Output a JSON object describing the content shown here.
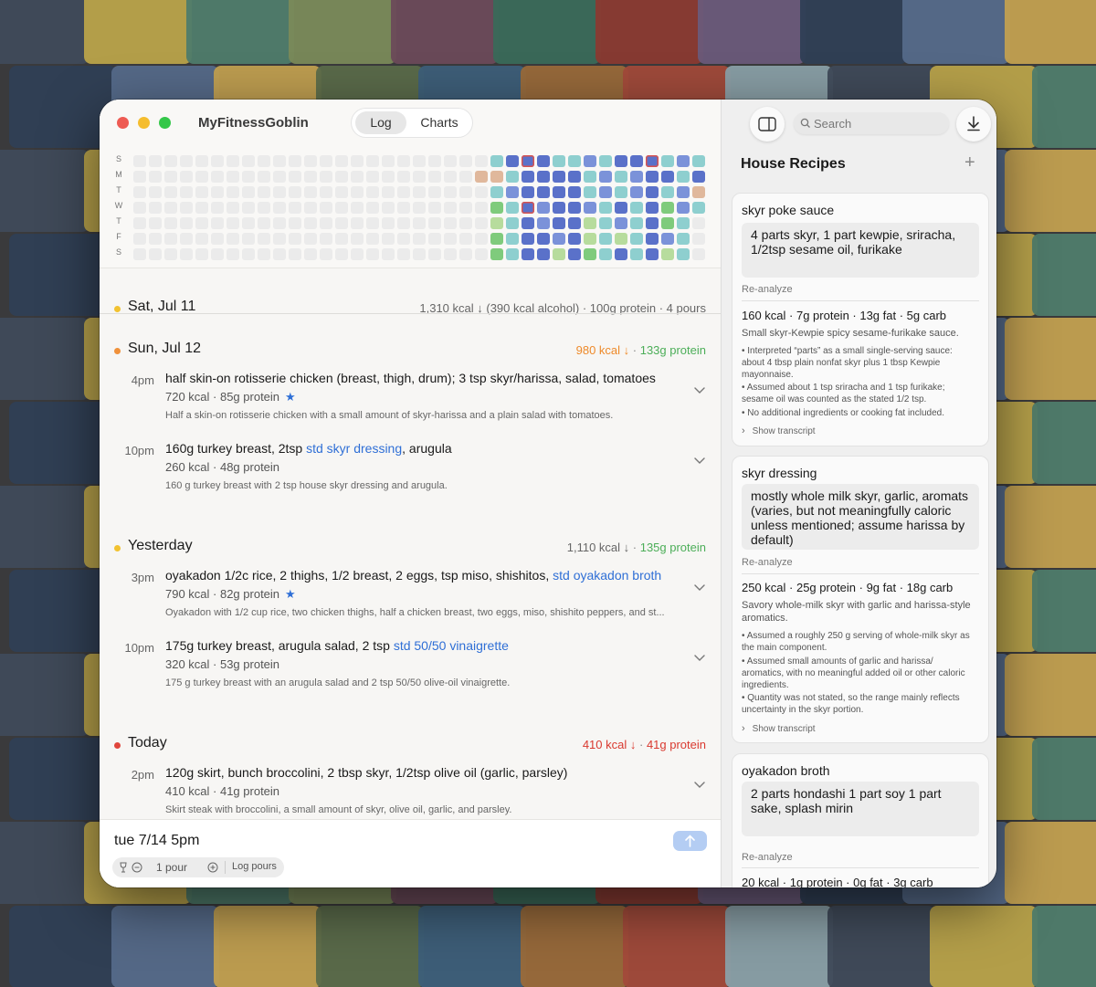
{
  "app": {
    "title": "MyFitnessGoblin",
    "tabs": [
      "Log",
      "Charts"
    ],
    "active_tab": "Log"
  },
  "heatmap": {
    "day_labels": [
      "S",
      "M",
      "T",
      "W",
      "T",
      "F",
      "S"
    ],
    "legend_colors": {
      "empty": "#ebebeb",
      "over": "#e0b89c",
      "teal": "#8ecfcf",
      "light_blue": "#7b92d9",
      "blue": "#5a71c9",
      "green": "#7fcb7c",
      "light_green": "#b7dc9d",
      "today_outline": "#d9534f"
    }
  },
  "days": [
    {
      "date": "Sat, Jul 11",
      "dot_color": "#f2c230",
      "summary": "1,310 kcal ↓ (390 kcal alcohol) · 100g protein · 4 pours",
      "entries": []
    },
    {
      "date": "Sun, Jul 12",
      "dot_color": "#f0913a",
      "summary_kcal": "980 kcal ↓",
      "summary_sep": " · ",
      "summary_protein": "133g protein",
      "kcal_color": "#ee8a2a",
      "protein_color": "#4cae58",
      "entries": [
        {
          "time": "4pm",
          "desc": "half skin-on rotisserie chicken (breast, thigh, drum); 3 tsp skyr/harissa, salad, tomatoes",
          "link": "",
          "after": "",
          "kcal": "720 kcal · 85g protein",
          "star": "★",
          "summary": "Half a skin-on rotisserie chicken with a small amount of skyr-harissa and a plain salad with tomatoes."
        },
        {
          "time": "10pm",
          "desc": "160g turkey breast, 2tsp ",
          "link": "std skyr dressing",
          "after": ", arugula",
          "kcal": "260 kcal · 48g protein",
          "star": "",
          "summary": "160 g turkey breast with 2 tsp house skyr dressing and arugula."
        }
      ]
    },
    {
      "date": "Yesterday",
      "dot_color": "#f2c230",
      "summary_kcal": "1,110 kcal ↓",
      "summary_sep": " · ",
      "summary_protein": "135g protein",
      "kcal_color": "#666666",
      "protein_color": "#4cae58",
      "entries": [
        {
          "time": "3pm",
          "desc": "oyakadon 1/2c rice, 2 thighs, 1/2 breast, 2 eggs, tsp miso, shishitos, ",
          "link": "std oyakadon broth",
          "after": "",
          "kcal": "790 kcal · 82g protein",
          "star": "★",
          "summary": "Oyakadon with 1/2 cup rice, two chicken thighs, half a chicken breast, two eggs, miso, shishito peppers, and st..."
        },
        {
          "time": "10pm",
          "desc": "175g turkey breast, arugula salad, 2 tsp ",
          "link": "std 50/50 vinaigrette",
          "after": "",
          "kcal": "320 kcal · 53g protein",
          "star": "",
          "summary": "175 g turkey breast with an arugula salad and 2 tsp 50/50 olive-oil vinaigrette."
        }
      ]
    },
    {
      "date": "Today",
      "dot_color": "#e0463c",
      "summary_kcal": "410 kcal ↓",
      "summary_sep": " · ",
      "summary_protein": "41g protein",
      "kcal_color": "#d9392f",
      "protein_color": "#d9392f",
      "entries": [
        {
          "time": "2pm",
          "desc": "120g skirt, bunch broccolini, 2 tbsp skyr, 1/2tsp olive oil (garlic, parsley)",
          "link": "",
          "after": "",
          "kcal": "410 kcal · 41g protein",
          "star": "",
          "summary": "Skirt steak with broccolini, a small amount of skyr, olive oil, garlic, and parsley."
        }
      ]
    }
  ],
  "composer": {
    "input": "tue 7/14 5pm",
    "pours": "1 pour",
    "log_pours": "Log pours"
  },
  "sidebar": {
    "search_placeholder": "Search",
    "title": "House Recipes",
    "add": "+",
    "recipes": [
      {
        "name": "skyr poke sauce",
        "ingredients": "4 parts skyr, 1 part kewpie, sriracha, 1/2tsp sesame oil, furikake",
        "reanalyze": "Re-analyze",
        "macros": "160 kcal · 7g protein · 13g fat · 5g carb",
        "desc": "Small skyr-Kewpie spicy sesame-furikake sauce.",
        "bullets": [
          "• Interpreted “parts” as a small single-serving sauce: about 4 tbsp plain nonfat skyr plus 1 tbsp Kewpie mayonnaise.",
          "• Assumed about 1 tsp sriracha and 1 tsp furikake; sesame oil was counted as the stated 1/2 tsp.",
          "• No additional ingredients or cooking fat included."
        ],
        "transcript": "Show transcript"
      },
      {
        "name": "skyr dressing",
        "ingredients": "mostly whole milk skyr, garlic, aromats (varies, but not meaningfully caloric unless mentioned; assume harissa by default)",
        "reanalyze": "Re-analyze",
        "macros": "250 kcal · 25g protein · 9g fat · 18g carb",
        "desc": "Savory whole-milk skyr with garlic and harissa-style aromatics.",
        "bullets": [
          "• Assumed a roughly 250 g serving of whole-milk skyr as the main component.",
          "• Assumed small amounts of garlic and harissa/ aromatics, with no meaningful added oil or other caloric ingredients.",
          "• Quantity was not stated, so the range mainly reflects uncertainty in the skyr portion."
        ],
        "transcript": "Show transcript"
      },
      {
        "name": "oyakadon broth",
        "ingredients": "2 parts hondashi 1 part soy 1 part sake, splash mirin",
        "reanalyze": "Re-analyze",
        "macros": "20 kcal · 1g protein · 0g fat · 3g carb"
      }
    ]
  }
}
